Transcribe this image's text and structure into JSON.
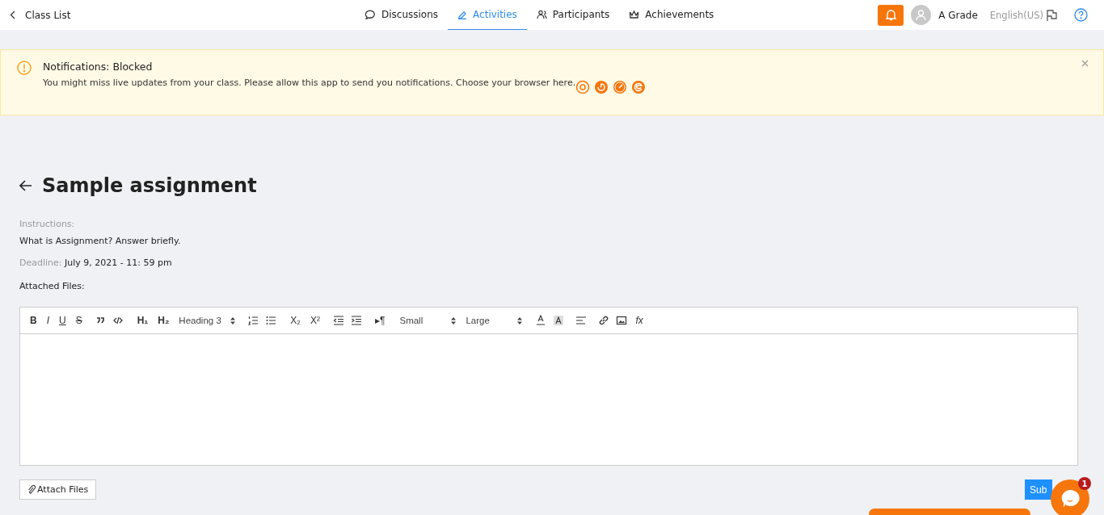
{
  "header": {
    "back_label": "Class List",
    "nav": [
      {
        "label": "Discussions",
        "selected": false
      },
      {
        "label": "Activities",
        "selected": true
      },
      {
        "label": "Participants",
        "selected": false
      },
      {
        "label": "Achievements",
        "selected": false
      }
    ],
    "user": "A Grade",
    "language": "English(US)"
  },
  "alert": {
    "title": "Notifications: Blocked",
    "message": "You might miss live updates from your class. Please allow this app to send you notifications. Choose your browser here."
  },
  "assignment": {
    "title": "Sample assignment",
    "instructions_label": "Instructions:",
    "instructions": "What is Assignment? Answer briefly.",
    "deadline_label": "Deadline:",
    "deadline": "July 9, 2021 - 11: 59 pm",
    "attached_label": "Attached Files:"
  },
  "toolbar": [
    [
      {
        "kind": "bold",
        "label": "B"
      },
      {
        "kind": "italic",
        "label": "I"
      },
      {
        "kind": "underline",
        "label": "U"
      },
      {
        "kind": "strike",
        "label": "S"
      }
    ],
    [
      {
        "kind": "quote"
      },
      {
        "kind": "code"
      }
    ],
    [
      {
        "kind": "bold",
        "label": "H₁"
      },
      {
        "kind": "bold",
        "label": "H₂"
      },
      {
        "kind": "select",
        "label": "Heading 3"
      }
    ],
    [
      {
        "kind": "ordered-list"
      },
      {
        "kind": "bullet-list"
      }
    ],
    [
      {
        "kind": "plain",
        "label": "X₂"
      },
      {
        "kind": "plain",
        "label": "X²"
      }
    ],
    [
      {
        "kind": "outdent"
      },
      {
        "kind": "indent"
      }
    ],
    [
      {
        "kind": "plain",
        "label": "▸¶"
      }
    ],
    [
      {
        "kind": "select",
        "label": "Small"
      },
      {
        "kind": "select",
        "label": "Large"
      }
    ],
    [
      {
        "kind": "text-color"
      },
      {
        "kind": "highlight"
      }
    ],
    [
      {
        "kind": "align"
      }
    ],
    [
      {
        "kind": "link"
      },
      {
        "kind": "image"
      },
      {
        "kind": "italic",
        "label": "fx"
      }
    ]
  ],
  "attach_button": "Attach Files",
  "submit_button": "Sub",
  "chat_badge": "1"
}
